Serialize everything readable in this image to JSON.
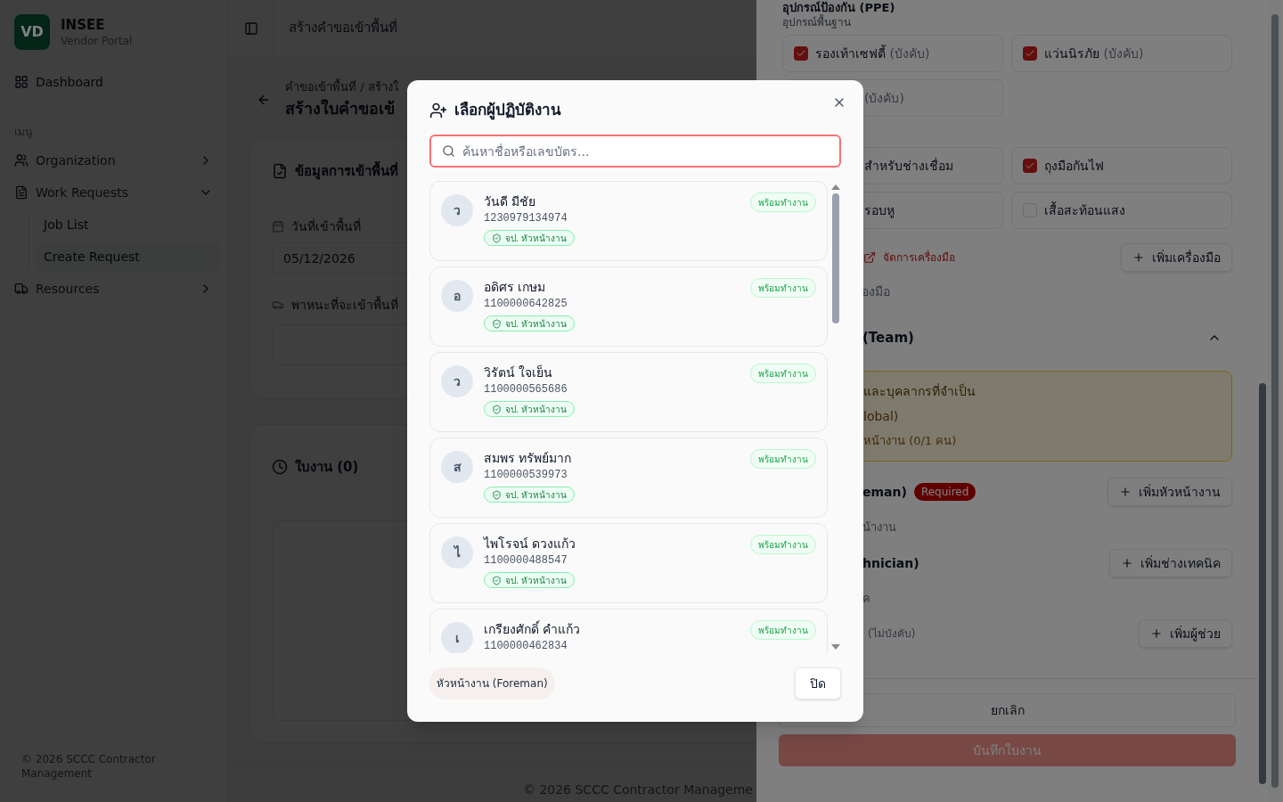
{
  "sidebar": {
    "logo": "VD",
    "brand": "INSEE",
    "subtitle": "Vendor Portal",
    "dashboard": "Dashboard",
    "section": "เมนู",
    "items": [
      {
        "label": "Organization",
        "expanded": false
      },
      {
        "label": "Work Requests",
        "expanded": true,
        "children": [
          {
            "label": "Job List",
            "selected": false
          },
          {
            "label": "Create Request",
            "selected": true
          }
        ]
      },
      {
        "label": "Resources",
        "expanded": false
      }
    ],
    "footer": "© 2026 SCCC Contractor Management"
  },
  "header": {
    "title": "สร้างคำขอเข้าพื้นที่"
  },
  "page": {
    "breadcrumb": "คำขอเข้าพื้นที่ / สร้างใ",
    "title": "สร้างใบคำขอเข้",
    "entry_card": {
      "title": "ข้อมูลการเข้าพื้นที่",
      "date_label": "วันที่เข้าพื้นที่",
      "date_value": "05/12/2026",
      "vehicle_label": "พาหนะที่จะเข้าพื้นที่"
    },
    "jobs_card": {
      "title": "ใบงาน (0)"
    },
    "footer": "© 2026 SCCC Contractor Manageme"
  },
  "sheet": {
    "ppe_title": "อุปกรณ์ป้องกัน (PPE)",
    "basic_label": "อุปกรณ์พื้นฐาน",
    "basic_items": [
      {
        "label": "รองเท้าเซฟตี้",
        "note": "(บังคับ)",
        "checked": true
      },
      {
        "label": "แว่นนิรภัย",
        "note": "(บังคับ)",
        "checked": true
      },
      {
        "note": "(บังคับ)"
      }
    ],
    "extra_items": [
      {
        "label": "สำหรับช่างเชื่อม"
      },
      {
        "label": "ถุงมือกันไฟ",
        "checked": true
      },
      {
        "label": "รอบหู"
      },
      {
        "label": "เสื้อสะท้อนแสง",
        "checked": false
      }
    ],
    "tools_link": "จัดการเครื่องมือ",
    "add_tool": "เพิ่มเครื่องมือ",
    "tools_empty": "องมือ",
    "team": {
      "title": "(Team)",
      "expanded": true,
      "notice": [
        "และบุคลากรที่จำเป็น",
        "lobal)",
        "หน้างาน (0/1 คน)"
      ],
      "roles": [
        {
          "title": "eman)",
          "badge": "Required",
          "button": "เพิ่มหัวหน้างาน",
          "empty": "น้างาน"
        },
        {
          "title": "hnician)",
          "button": "เพิ่มช่างเทคนิค",
          "empty": "ค"
        },
        {
          "note": "(ไม่บังคับ)",
          "button": "เพิ่มผู้ช่วย"
        }
      ]
    },
    "cancel": "ยกเลิก",
    "save": "บันทึกใบงาน",
    "save_disabled": true
  },
  "modal": {
    "title": "เลือกผู้ปฏิบัติงาน",
    "search_placeholder": "ค้นหาชื่อหรือเลขบัตร...",
    "workers": [
      {
        "initial": "ว",
        "name": "วันดี มีชัย",
        "id_number": "1230979134974",
        "status": "พร้อมทำงาน",
        "role": "จป. หัวหน้างาน"
      },
      {
        "initial": "อ",
        "name": "อดิศร เกษม",
        "id_number": "1100000642825",
        "status": "พร้อมทำงาน",
        "role": "จป. หัวหน้างาน"
      },
      {
        "initial": "ว",
        "name": "วิรัตน์ ใจเย็น",
        "id_number": "1100000565686",
        "status": "พร้อมทำงาน",
        "role": "จป. หัวหน้างาน"
      },
      {
        "initial": "ส",
        "name": "สมพร ทรัพย์มาก",
        "id_number": "1100000539973",
        "status": "พร้อมทำงาน",
        "role": "จป. หัวหน้างาน"
      },
      {
        "initial": "ไ",
        "name": "ไพโรจน์ ดวงแก้ว",
        "id_number": "1100000488547",
        "status": "พร้อมทำงาน",
        "role": "จป. หัวหน้างาน"
      },
      {
        "initial": "เ",
        "name": "เกรียงศักดิ์ คำแก้ว",
        "id_number": "1100000462834",
        "status": "พร้อมทำงาน"
      }
    ],
    "filter": "หัวหน้างาน (Foreman)",
    "close": "ปิด"
  }
}
